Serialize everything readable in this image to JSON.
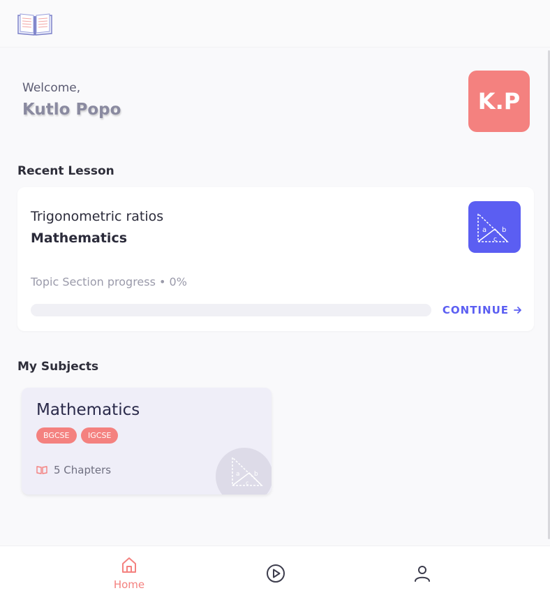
{
  "app": {
    "logo_icon": "open-book-icon"
  },
  "greeting": {
    "welcome": "Welcome,",
    "name": "Kutlo Popo",
    "initials": "K.P",
    "avatar_color": "#f4817f"
  },
  "recent": {
    "section_title": "Recent Lesson",
    "lesson_name": "Trigonometric ratios",
    "subject": "Mathematics",
    "icon": "triangle-abc-icon",
    "progress_text": "Topic Section progress • 0%",
    "progress_percent": 0,
    "continue_label": "CONTINUE",
    "accent": "#5b5ef2"
  },
  "subjects": {
    "section_title": "My Subjects",
    "items": [
      {
        "name": "Mathematics",
        "tags": [
          "BGCSE",
          "IGCSE"
        ],
        "chapters": "5 Chapters",
        "icon": "triangle-abc-icon"
      }
    ]
  },
  "nav": {
    "items": [
      {
        "label": "Home",
        "icon": "home-icon",
        "active": true
      },
      {
        "label": "",
        "icon": "play-circle-icon",
        "active": false
      },
      {
        "label": "",
        "icon": "user-icon",
        "active": false
      }
    ],
    "active_color": "#f4817f",
    "inactive_color": "#3c3c4c"
  }
}
